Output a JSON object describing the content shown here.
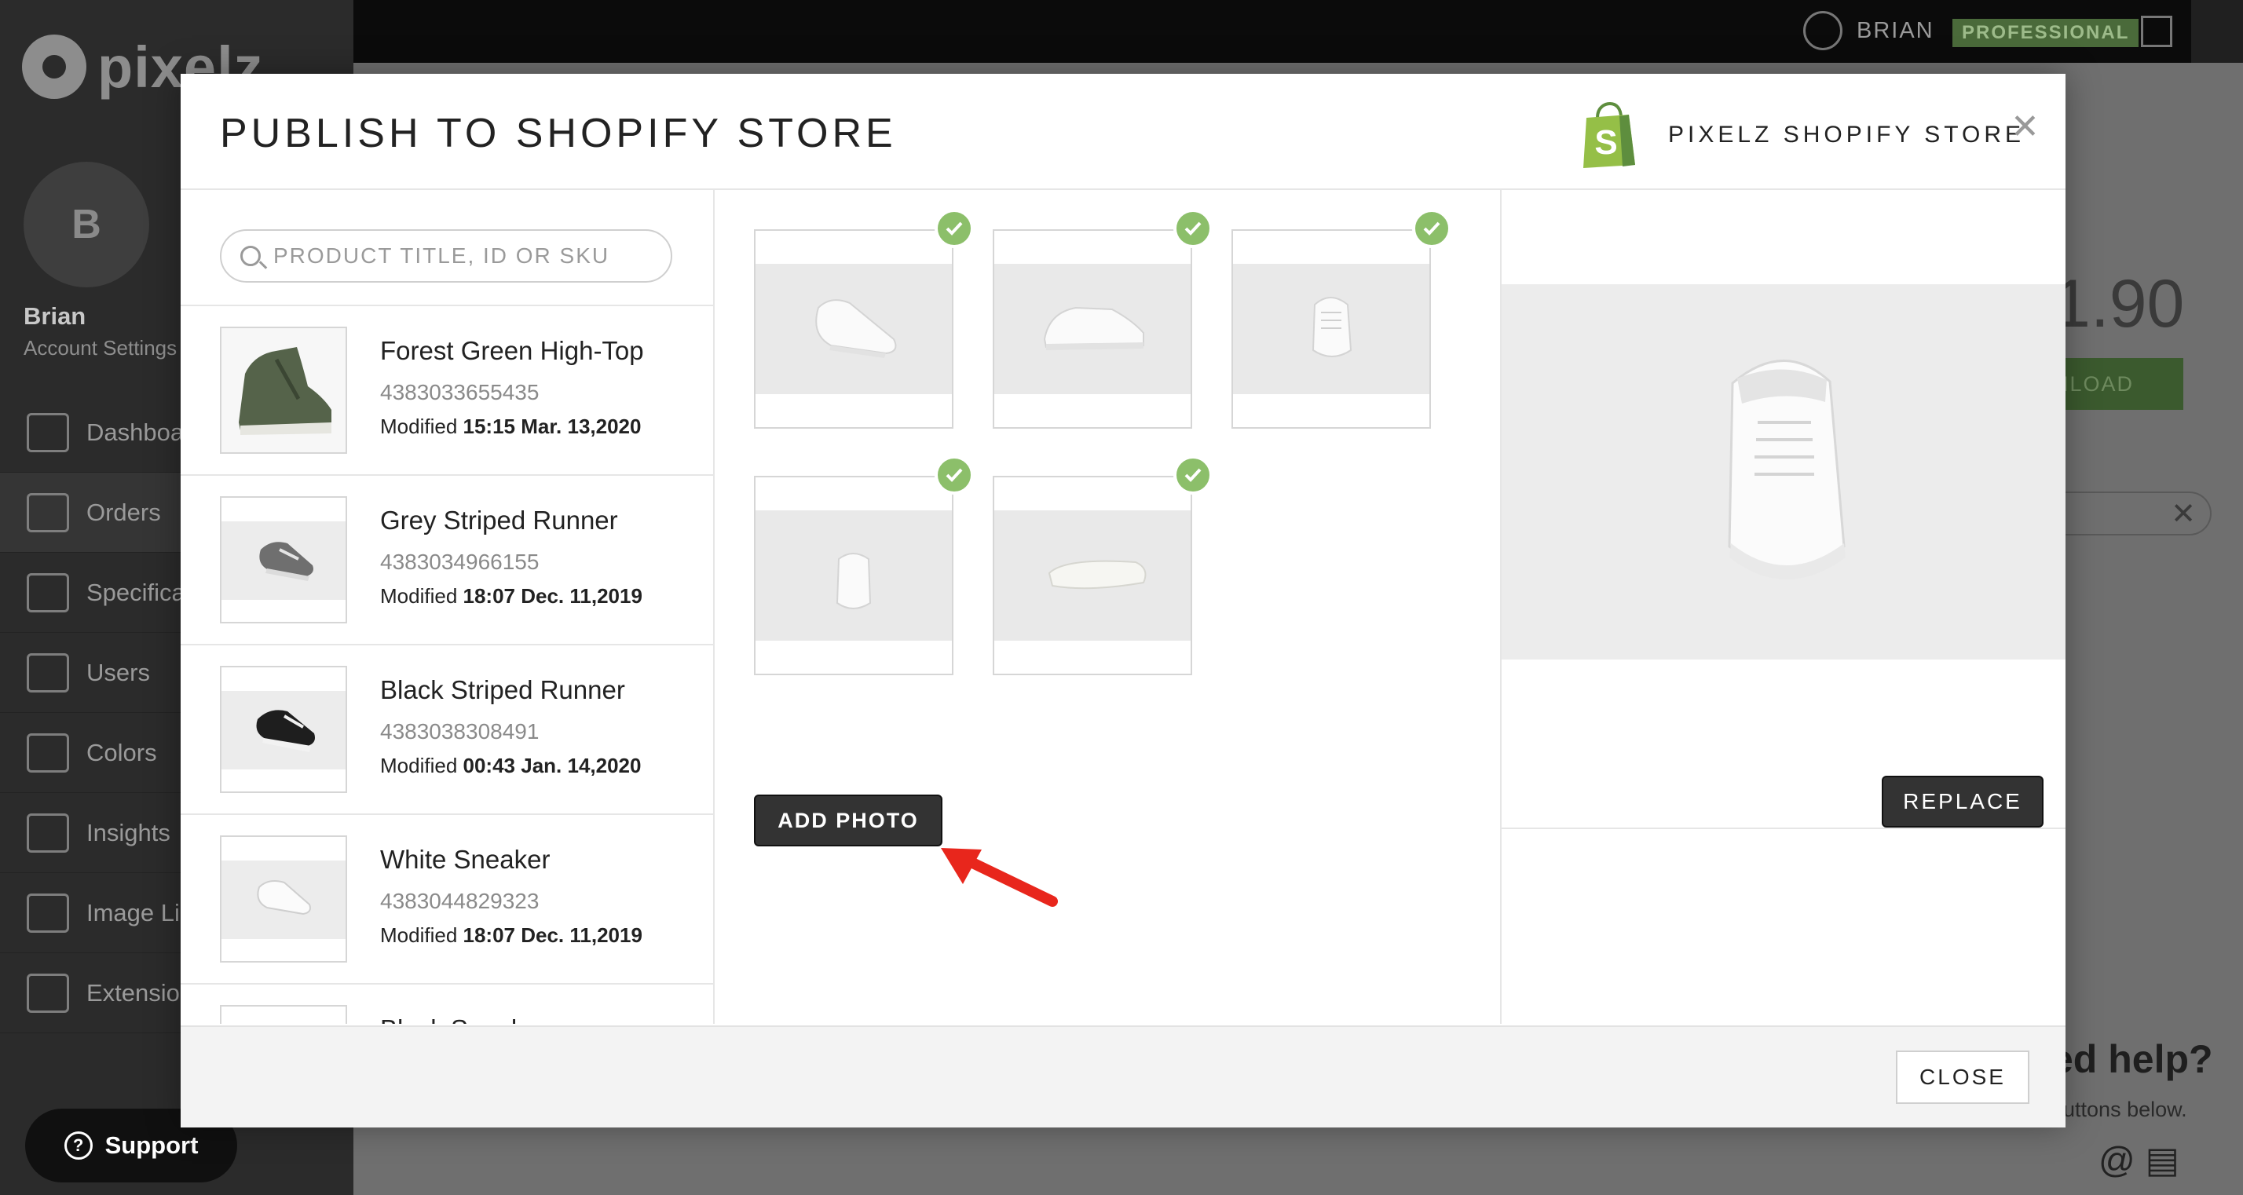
{
  "app": {
    "logo_text": "pixelz",
    "topbar": {
      "user_name": "BRIAN",
      "plan_badge": "PROFESSIONAL"
    },
    "sidebar": {
      "avatar_initial": "B",
      "user_name": "Brian",
      "account_link": "Account Settings",
      "items": [
        {
          "label": "Dashboard",
          "icon": "home-icon"
        },
        {
          "label": "Orders",
          "icon": "orders-icon"
        },
        {
          "label": "Specifications",
          "icon": "sliders-icon"
        },
        {
          "label": "Users",
          "icon": "users-icon"
        },
        {
          "label": "Colors",
          "icon": "colors-icon"
        },
        {
          "label": "Insights",
          "icon": "chart-icon"
        },
        {
          "label": "Image Library",
          "icon": "grid-icon"
        },
        {
          "label": "Extensions",
          "icon": "extensions-icon"
        }
      ]
    },
    "background": {
      "price_fragment": "1.90",
      "download_fragment": "NLOAD",
      "help_title": "ed help?",
      "help_sub": "buttons below."
    },
    "support_label": "Support"
  },
  "modal": {
    "title": "PUBLISH TO SHOPIFY STORE",
    "store_name": "PIXELZ SHOPIFY STORE",
    "search": {
      "placeholder": "PRODUCT TITLE, ID OR SKU",
      "value": ""
    },
    "modified_label": "Modified",
    "products": [
      {
        "name": "Forest Green High-Top",
        "id": "4383033655435",
        "modified": "15:15 Mar. 13,2020"
      },
      {
        "name": "Grey Striped Runner",
        "id": "4383034966155",
        "modified": "18:07 Dec. 11,2019"
      },
      {
        "name": "Black Striped Runner",
        "id": "4383038308491",
        "modified": "00:43 Jan. 14,2020"
      },
      {
        "name": "White Sneaker",
        "id": "4383044829323",
        "modified": "18:07 Dec. 11,2019"
      },
      {
        "name": "Black Sneaker",
        "id": "",
        "modified": ""
      }
    ],
    "photos": [
      {
        "selected": true,
        "view": "three-quarter"
      },
      {
        "selected": true,
        "view": "side"
      },
      {
        "selected": true,
        "view": "front"
      },
      {
        "selected": true,
        "view": "back"
      },
      {
        "selected": true,
        "view": "sole"
      }
    ],
    "add_photo_label": "ADD PHOTO",
    "replace_label": "REPLACE",
    "close_label": "CLOSE",
    "colors": {
      "check": "#8cbf6a",
      "shopify_green": "#95bf47",
      "button_dark": "#333333",
      "arrow": "#e8261c"
    }
  }
}
